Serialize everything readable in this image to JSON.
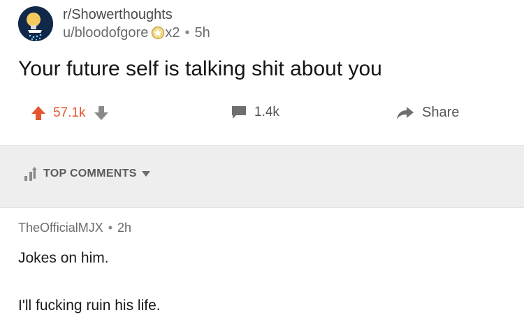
{
  "post": {
    "subreddit": "r/Showerthoughts",
    "author": "u/bloodofgore",
    "award_count": "x2",
    "age": "5h",
    "title": "Your future self is talking shit about you"
  },
  "actions": {
    "score": "57.1k",
    "comments_count": "1.4k",
    "share_label": "Share"
  },
  "sort": {
    "label": "TOP COMMENTS"
  },
  "comment": {
    "author": "TheOfficialMJX",
    "age": "2h",
    "line1": "Jokes on him.",
    "line2": "I'll fucking ruin his life."
  },
  "icons": {
    "avatar": "showerhead-lightbulb-avatar",
    "award": "silver-award-icon",
    "upvote": "upvote-arrow-icon",
    "downvote": "downvote-arrow-icon",
    "comment": "comment-bubble-icon",
    "share": "share-arrow-icon",
    "sort": "top-sort-icon",
    "dropdown": "caret-down-icon"
  },
  "colors": {
    "upvote_active": "#e4572e",
    "text_primary": "#1a1a1b",
    "text_muted": "#6b6b6b",
    "band_bg": "#eeeeef"
  }
}
